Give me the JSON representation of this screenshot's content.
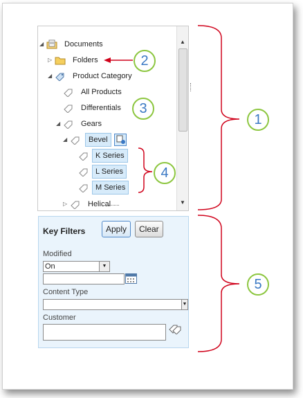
{
  "tree": {
    "root": "Documents",
    "folders": "Folders",
    "product_category": "Product Category",
    "all_products": "All Products",
    "differentials": "Differentials",
    "gears": "Gears",
    "bevel": "Bevel",
    "k_series": "K Series",
    "l_series": "L Series",
    "m_series": "M Series",
    "helical": "Helical"
  },
  "filters": {
    "title": "Key Filters",
    "apply": "Apply",
    "clear": "Clear",
    "modified_label": "Modified",
    "modified_value": "On",
    "content_type_label": "Content Type",
    "customer_label": "Customer"
  },
  "callouts": [
    "1",
    "2",
    "3",
    "4",
    "5"
  ],
  "icons": {
    "expanded": "triangle-down-icon",
    "collapsed": "triangle-right-icon",
    "documents": "library-icon",
    "folder": "folder-icon",
    "term_set": "term-set-icon",
    "tag": "tag-icon",
    "calendar": "calendar-icon",
    "browse_terms": "tags-browse-icon"
  },
  "colors": {
    "bracket": "#d0021b",
    "callout_ring": "#8cc63f",
    "callout_text": "#3a78c4",
    "chip_bg": "#d7ebfa"
  }
}
